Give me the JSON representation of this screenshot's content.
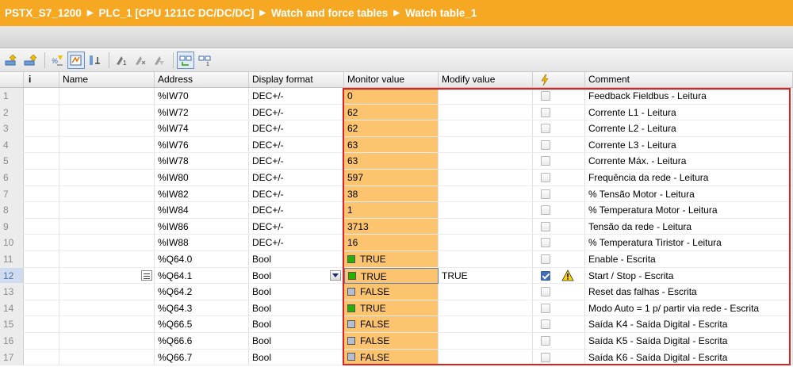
{
  "breadcrumb": [
    "PSTX_S7_1200",
    "PLC_1 [CPU 1211C DC/DC/DC]",
    "Watch and force tables",
    "Watch table_1"
  ],
  "toolbar": {
    "icons": [
      "insert-row-icon",
      "add-row-icon",
      "show-all-icon",
      "modify-icon",
      "monitor-once-icon",
      "force-icon",
      "force-clear-icon",
      "force-all-icon",
      "monitor-all-icon",
      "monitor-now-icon"
    ]
  },
  "columns": {
    "info": "i",
    "name": "Name",
    "address": "Address",
    "display_format": "Display format",
    "monitor_value": "Monitor value",
    "modify_value": "Modify value",
    "comment": "Comment"
  },
  "rows": [
    {
      "num": "1",
      "name": "",
      "address": "%IW70",
      "format": "DEC+/-",
      "monitor": "0",
      "modify": "",
      "comment": "Feedback Fieldbus - Leitura"
    },
    {
      "num": "2",
      "name": "",
      "address": "%IW72",
      "format": "DEC+/-",
      "monitor": "62",
      "modify": "",
      "comment": "Corrente L1 - Leitura"
    },
    {
      "num": "3",
      "name": "",
      "address": "%IW74",
      "format": "DEC+/-",
      "monitor": "62",
      "modify": "",
      "comment": "Corrente L2 - Leitura"
    },
    {
      "num": "4",
      "name": "",
      "address": "%IW76",
      "format": "DEC+/-",
      "monitor": "63",
      "modify": "",
      "comment": "Corrente L3 - Leitura"
    },
    {
      "num": "5",
      "name": "",
      "address": "%IW78",
      "format": "DEC+/-",
      "monitor": "63",
      "modify": "",
      "comment": "Corrente Máx. - Leitura"
    },
    {
      "num": "6",
      "name": "",
      "address": "%IW80",
      "format": "DEC+/-",
      "monitor": "597",
      "modify": "",
      "comment": "Frequência da rede - Leitura"
    },
    {
      "num": "7",
      "name": "",
      "address": "%IW82",
      "format": "DEC+/-",
      "monitor": "38",
      "modify": "",
      "comment": "% Tensão Motor - Leitura"
    },
    {
      "num": "8",
      "name": "",
      "address": "%IW84",
      "format": "DEC+/-",
      "monitor": "1",
      "modify": "",
      "comment": "% Temperatura Motor - Leitura"
    },
    {
      "num": "9",
      "name": "",
      "address": "%IW86",
      "format": "DEC+/-",
      "monitor": "3713",
      "modify": "",
      "comment": "Tensão da rede - Leitura"
    },
    {
      "num": "10",
      "name": "",
      "address": "%IW88",
      "format": "DEC+/-",
      "monitor": "16",
      "modify": "",
      "comment": "% Temperatura Tiristor - Leitura"
    },
    {
      "num": "11",
      "name": "",
      "address": "%Q64.0",
      "format": "Bool",
      "monitor": "TRUE",
      "modify": "",
      "comment": "Enable - Escrita"
    },
    {
      "num": "12",
      "name": "",
      "address": "%Q64.1",
      "format": "Bool",
      "monitor": "TRUE",
      "modify": "TRUE",
      "comment": "Start / Stop - Escrita"
    },
    {
      "num": "13",
      "name": "",
      "address": "%Q64.2",
      "format": "Bool",
      "monitor": "FALSE",
      "modify": "",
      "comment": "Reset das falhas - Escrita"
    },
    {
      "num": "14",
      "name": "",
      "address": "%Q64.3",
      "format": "Bool",
      "monitor": "TRUE",
      "modify": "",
      "comment": "Modo Auto = 1 p/ partir via rede - Escrita"
    },
    {
      "num": "15",
      "name": "",
      "address": "%Q66.5",
      "format": "Bool",
      "monitor": "FALSE",
      "modify": "",
      "comment": "Saída K4 - Saída Digital - Escrita"
    },
    {
      "num": "16",
      "name": "",
      "address": "%Q66.6",
      "format": "Bool",
      "monitor": "FALSE",
      "modify": "",
      "comment": "Saída K5 - Saída Digital - Escrita"
    },
    {
      "num": "17",
      "name": "",
      "address": "%Q66.7",
      "format": "Bool",
      "monitor": "FALSE",
      "modify": "",
      "comment": "Saída K6 - Saída Digital - Escrita"
    }
  ],
  "selected_row": "12",
  "checked_rows": [
    "12"
  ],
  "warning_rows": [
    "12"
  ],
  "colors": {
    "title_bar": "#f7a823",
    "monitor_column": "#fcc46f",
    "true_indicator": "#28b000",
    "false_indicator": "#b7bdd0",
    "highlight_box": "#e02020"
  }
}
